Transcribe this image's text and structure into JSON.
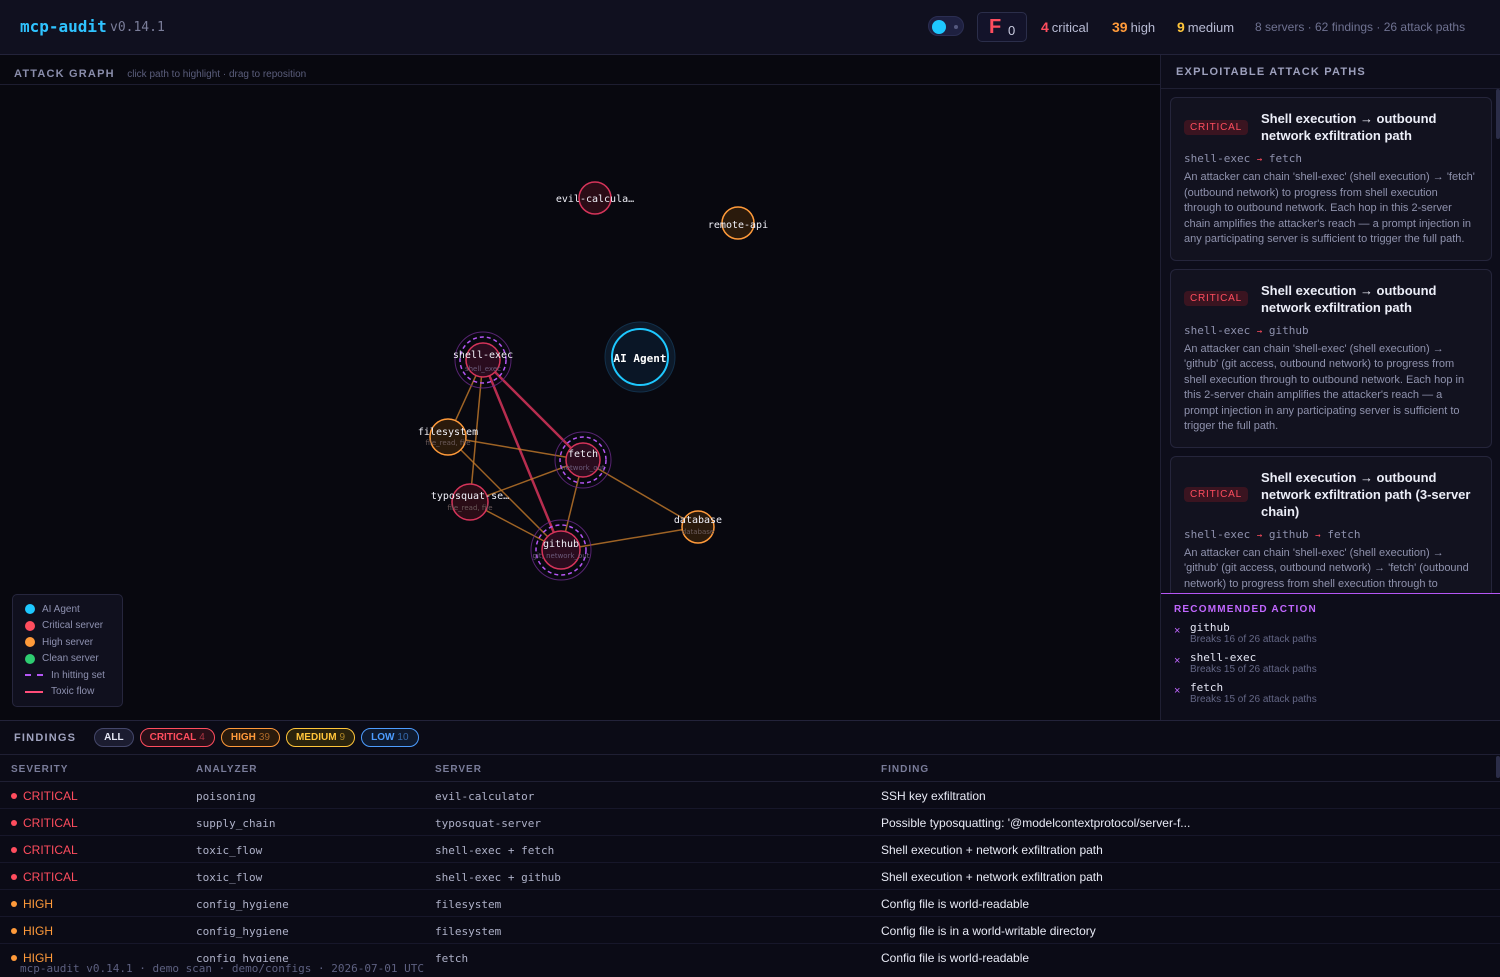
{
  "header": {
    "brand": "mcp-audit",
    "version": "v0.14.1",
    "grade_letter": "F",
    "grade_score": "0",
    "critical_count": "4",
    "critical_label": "critical",
    "high_count": "39",
    "high_label": "high",
    "medium_count": "9",
    "medium_label": "medium",
    "summary": "8 servers · 62 findings · 26 attack paths"
  },
  "graph": {
    "title": "ATTACK GRAPH",
    "hint": "click path to highlight · drag to reposition",
    "nodes": [
      {
        "id": "evil-calculator",
        "label": "evil-calcula…",
        "sub": "",
        "kind": "critical"
      },
      {
        "id": "remote-api",
        "label": "remote-api",
        "sub": "",
        "kind": "high"
      },
      {
        "id": "ai-agent",
        "label": "AI Agent",
        "sub": "",
        "kind": "agent"
      },
      {
        "id": "shell-exec",
        "label": "shell-exec",
        "sub": "shell_exec",
        "kind": "critical-hit"
      },
      {
        "id": "filesystem",
        "label": "filesystem",
        "sub": "file_read, file",
        "kind": "high"
      },
      {
        "id": "fetch",
        "label": "fetch",
        "sub": "network_out",
        "kind": "critical-hit"
      },
      {
        "id": "typosquat-server",
        "label": "typosquat-se…",
        "sub": "file_read, file",
        "kind": "critical"
      },
      {
        "id": "database",
        "label": "database",
        "sub": "database",
        "kind": "high"
      },
      {
        "id": "github",
        "label": "github",
        "sub": "git, network_out",
        "kind": "critical-hit"
      }
    ]
  },
  "legend": [
    {
      "label": "AI Agent",
      "type": "dot",
      "color": "#1ec8ff"
    },
    {
      "label": "Critical server",
      "type": "dot",
      "color": "#ff4d5e"
    },
    {
      "label": "High server",
      "type": "dot",
      "color": "#ff9a3a"
    },
    {
      "label": "Clean server",
      "type": "dot",
      "color": "#2ecc71"
    },
    {
      "label": "In hitting set",
      "type": "dash",
      "color": "#b556f5"
    },
    {
      "label": "Toxic flow",
      "type": "line",
      "color": "#ff4d7a"
    }
  ],
  "side": {
    "title": "EXPLOITABLE ATTACK PATHS",
    "cards": [
      {
        "badge": "CRITICAL",
        "title": "Shell execution → outbound network exfiltration path",
        "chain": [
          "shell-exec",
          "fetch"
        ],
        "desc": "An attacker can chain 'shell-exec' (shell execution) → 'fetch' (outbound network) to progress from shell execution through to outbound network. Each hop in this 2-server chain amplifies the attacker's reach — a prompt injection in any participating server is sufficient to trigger the full path."
      },
      {
        "badge": "CRITICAL",
        "title": "Shell execution → outbound network exfiltration path",
        "chain": [
          "shell-exec",
          "github"
        ],
        "desc": "An attacker can chain 'shell-exec' (shell execution) → 'github' (git access, outbound network) to progress from shell execution through to outbound network. Each hop in this 2-server chain amplifies the attacker's reach — a prompt injection in any participating server is sufficient to trigger the full path."
      },
      {
        "badge": "CRITICAL",
        "title": "Shell execution → outbound network exfiltration path (3-server chain)",
        "chain": [
          "shell-exec",
          "github",
          "fetch"
        ],
        "desc": "An attacker can chain 'shell-exec' (shell execution) → 'github' (git access, outbound network) → 'fetch' (outbound network) to progress from shell execution through to outbound network."
      }
    ],
    "rec_title": "RECOMMENDED ACTION",
    "recommendations": [
      {
        "name": "github",
        "sub": "Breaks 16 of 26 attack paths"
      },
      {
        "name": "shell-exec",
        "sub": "Breaks 15 of 26 attack paths"
      },
      {
        "name": "fetch",
        "sub": "Breaks 15 of 26 attack paths"
      }
    ]
  },
  "findings": {
    "title": "FINDINGS",
    "chips": {
      "all": "ALL",
      "critical": "CRITICAL",
      "critical_n": "4",
      "high": "HIGH",
      "high_n": "39",
      "medium": "MEDIUM",
      "medium_n": "9",
      "low": "LOW",
      "low_n": "10"
    },
    "columns": [
      "SEVERITY",
      "ANALYZER",
      "SERVER",
      "FINDING"
    ],
    "rows": [
      {
        "severity": "CRITICAL",
        "color": "#ff4d5e",
        "analyzer": "poisoning",
        "server": "evil-calculator",
        "finding": "SSH key exfiltration"
      },
      {
        "severity": "CRITICAL",
        "color": "#ff4d5e",
        "analyzer": "supply_chain",
        "server": "typosquat-server",
        "finding": "Possible typosquatting: '@modelcontextprotocol/server-f..."
      },
      {
        "severity": "CRITICAL",
        "color": "#ff4d5e",
        "analyzer": "toxic_flow",
        "server": "shell-exec + fetch",
        "finding": "Shell execution + network exfiltration path"
      },
      {
        "severity": "CRITICAL",
        "color": "#ff4d5e",
        "analyzer": "toxic_flow",
        "server": "shell-exec + github",
        "finding": "Shell execution + network exfiltration path"
      },
      {
        "severity": "HIGH",
        "color": "#ff9a3a",
        "analyzer": "config_hygiene",
        "server": "filesystem",
        "finding": "Config file is world-readable"
      },
      {
        "severity": "HIGH",
        "color": "#ff9a3a",
        "analyzer": "config_hygiene",
        "server": "filesystem",
        "finding": "Config file is in a world-writable directory"
      },
      {
        "severity": "HIGH",
        "color": "#ff9a3a",
        "analyzer": "config_hygiene",
        "server": "fetch",
        "finding": "Config file is world-readable"
      }
    ]
  },
  "footer": "mcp-audit v0.14.1 · demo scan · demo/configs · 2026-07-01 UTC"
}
